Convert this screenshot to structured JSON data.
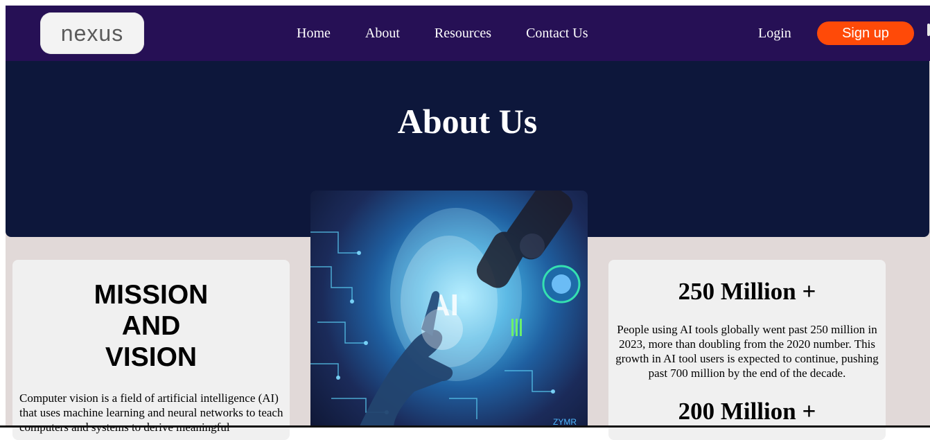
{
  "brand": {
    "logo_text": "nexus"
  },
  "nav": {
    "links": [
      "Home",
      "About",
      "Resources",
      "Contact Us"
    ],
    "login_label": "Login",
    "signup_label": "Sign up"
  },
  "hero": {
    "title": "About Us"
  },
  "mission": {
    "title_lines": [
      "MISSION",
      "AND",
      "VISION"
    ],
    "text": "Computer vision is a field of artificial intelligence (AI) that uses machine learning and neural networks to teach computers and systems to derive meaningful"
  },
  "image": {
    "overlay_text": "AI",
    "watermark": "ZYMR"
  },
  "stats": {
    "first_value": "250 Million +",
    "first_text": "People using AI tools globally went past 250 million in 2023, more than doubling from the 2020 number. This growth in AI tool users is expected to continue, pushing past 700 million by the end of the decade.",
    "second_value": "200 Million +"
  },
  "colors": {
    "navbar": "#261055",
    "hero": "#0d173b",
    "signup": "#ff4a08",
    "page_background": "#e1d9d8",
    "card": "#f0f0f0"
  }
}
